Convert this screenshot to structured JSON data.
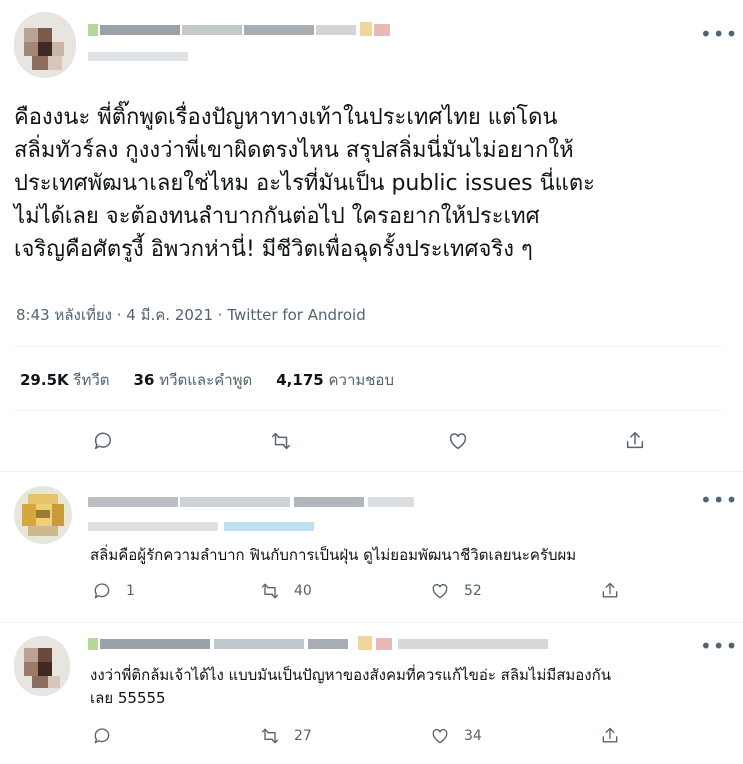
{
  "main_tweet": {
    "body_lines": [
      "คืองงนะ พี่ติ๊กพูดเรื่องปัญหาทางเท้าในประเทศไทย แต่โดน",
      "สลิ่มทัวร์ลง กูงงว่าพี่เขาผิดตรงไหน สรุปสลิ่มนี่มันไม่อยากให้",
      "ประเทศพัฒนาเลยใช่ไหม อะไรที่มันเป็น public issues นี่แตะ",
      "ไม่ได้เลย จะต้องทนลำบากกันต่อไป ใครอยากให้ประเทศ",
      "เจริญคือศัตรูงี้ อิพวกห่านี่! มีชีวิตเพื่อฉุดรั้งประเทศจริง ๆ"
    ],
    "timestamp": "8:43 หลังเที่ยง · 4 มี.ค. 2021 · Twitter for Android",
    "stats": {
      "retweets_count": "29.5K",
      "retweets_label": "รีทวีต",
      "quotes_count": "36",
      "quotes_label": "ทวีตและคำพูด",
      "likes_count": "4,175",
      "likes_label": "ความชอบ"
    }
  },
  "replies": [
    {
      "text_lines": [
        "สลิ่มคือผู้รักความลำบาก ฟินกับการเป็นฝุ่น ดูไม่ยอมพัฒนาชีวิตเลยนะครับผม"
      ],
      "reply_count": "1",
      "retweet_count": "40",
      "like_count": "52"
    },
    {
      "text_lines": [
        "งงว่าพี่ติกล้มเจ้าได้ไง แบบมันเป็นปัญหาของสังคมที่ควรแก้ไขอ่ะ สลิมไม่มีสมองกัน",
        "เลย 55555"
      ],
      "reply_count": "",
      "retweet_count": "27",
      "like_count": "34"
    }
  ],
  "icons": [
    "more-icon",
    "reply-icon",
    "retweet-icon",
    "like-icon",
    "share-icon"
  ],
  "colors": {
    "text": "#0f1419",
    "muted": "#536471",
    "divider": "#eff3f4",
    "link_blur": "#a8d8f0"
  }
}
